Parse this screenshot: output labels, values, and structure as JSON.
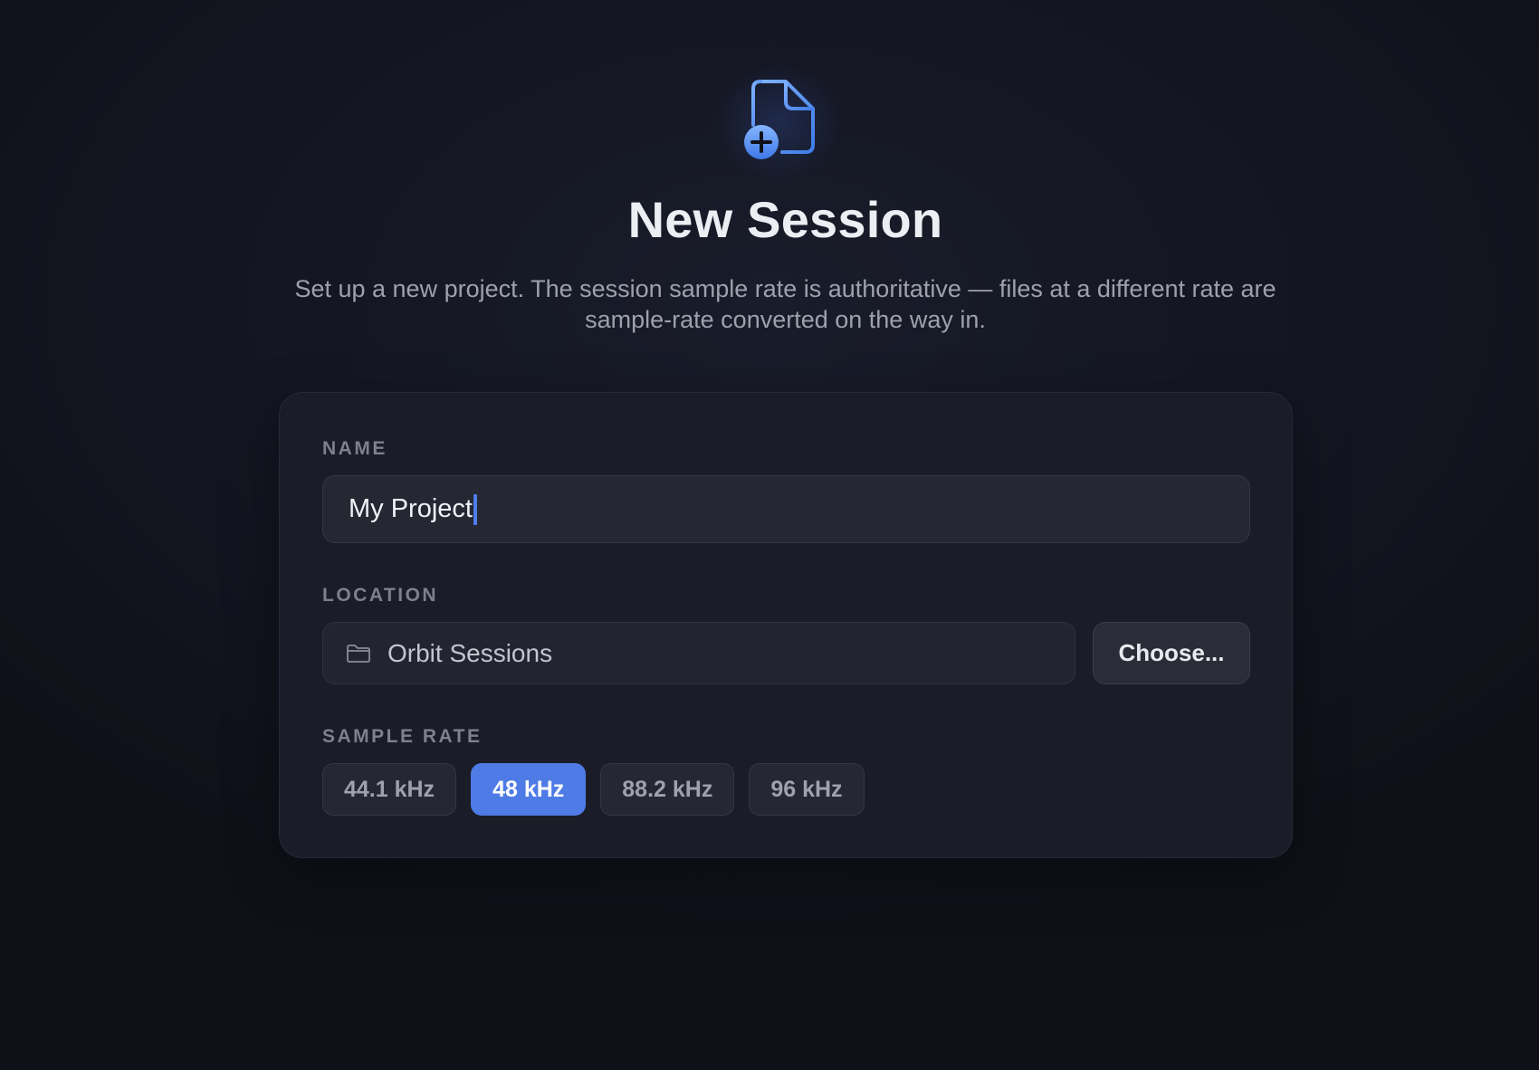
{
  "header": {
    "icon": "document-add-icon",
    "title": "New Session",
    "subtitle": "Set up a new project. The session sample rate is authoritative — files at a different rate are sample-rate converted on the way in."
  },
  "form": {
    "name": {
      "label": "NAME",
      "value": "My Project"
    },
    "location": {
      "label": "LOCATION",
      "icon": "folder-icon",
      "value": "Orbit Sessions",
      "choose_label": "Choose..."
    },
    "sample_rate": {
      "label": "SAMPLE RATE",
      "options": [
        "44.1 kHz",
        "48 kHz",
        "88.2 kHz",
        "96 kHz"
      ],
      "selected": "48 kHz"
    }
  },
  "colors": {
    "accent": "#4e7be6",
    "background": "#131521",
    "card": "#1a1c27"
  }
}
